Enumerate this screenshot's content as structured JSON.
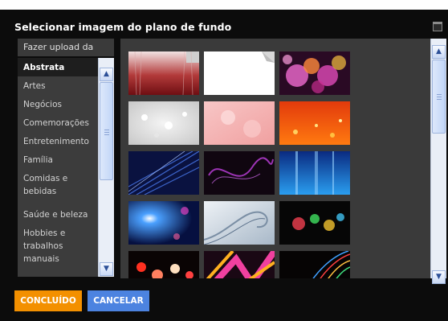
{
  "dialog": {
    "title": "Selecionar imagem do plano de fundo"
  },
  "sidebar": {
    "upload_label": "Fazer upload da",
    "categories": [
      {
        "label": "Abstrata",
        "selected": true
      },
      {
        "label": "Artes"
      },
      {
        "label": "Negócios"
      },
      {
        "label": "Comemorações"
      },
      {
        "label": "Entretenimento"
      },
      {
        "label": "Família"
      },
      {
        "label": "Comidas e bebidas"
      },
      {
        "label": "Saúde e beleza"
      },
      {
        "label": "Hobbies e trabalhos manuais"
      }
    ]
  },
  "gallery": {
    "thumbnails": [
      {
        "name": "dark-red-gradient"
      },
      {
        "name": "white-page-curl"
      },
      {
        "name": "pink-bokeh"
      },
      {
        "name": "silver-sparkle"
      },
      {
        "name": "peach-bokeh"
      },
      {
        "name": "orange-red-sparks"
      },
      {
        "name": "blue-light-streaks"
      },
      {
        "name": "purple-smoke"
      },
      {
        "name": "blue-vertical-rays"
      },
      {
        "name": "blue-starburst"
      },
      {
        "name": "silver-swirl"
      },
      {
        "name": "colorful-bokeh-dark"
      },
      {
        "name": "red-bokeh-lights"
      },
      {
        "name": "pink-ribbon-stripes"
      },
      {
        "name": "neon-light-trails"
      }
    ]
  },
  "footer": {
    "done_label": "CONCLUÍDO",
    "cancel_label": "CANCELAR"
  },
  "colors": {
    "dialog_bg": "#0c0c0c",
    "done_button": "#f39000",
    "cancel_button": "#4c83e0"
  }
}
